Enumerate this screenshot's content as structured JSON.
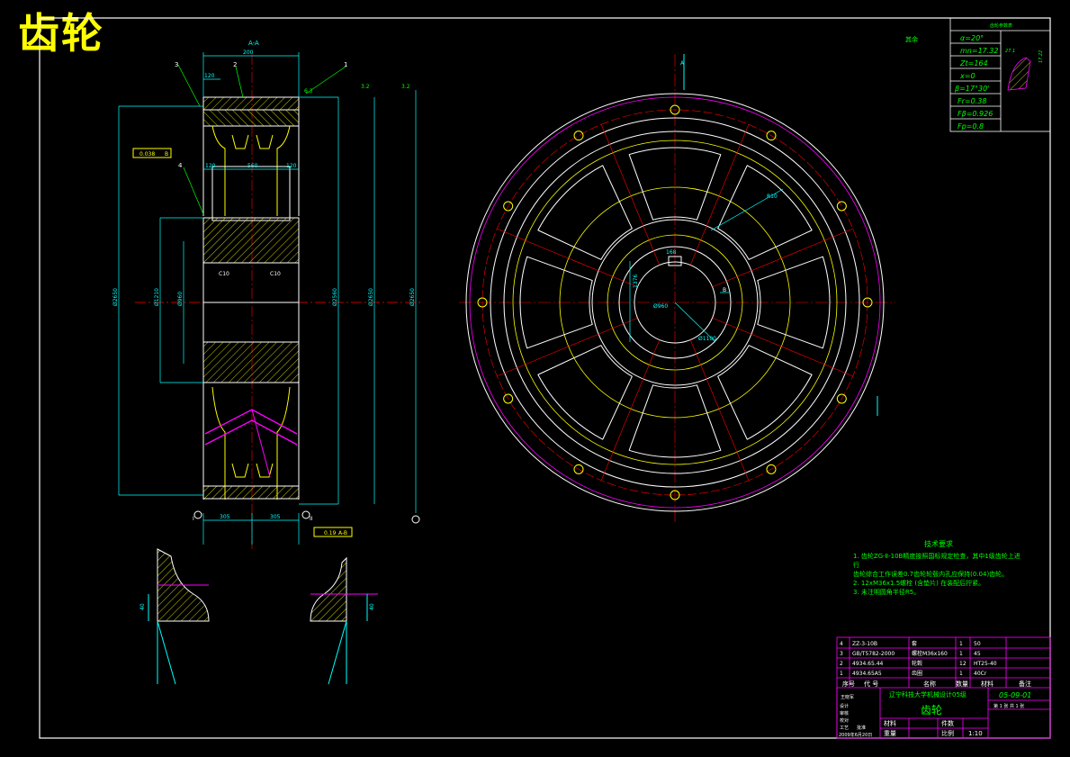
{
  "title": "齿轮",
  "section_label": "A-A",
  "view_label_a": "A",
  "dimensions": {
    "top_width": "200",
    "hub_width": "560",
    "rim_120_left": "120",
    "rim_120_right": "120",
    "rim_120_top": "120",
    "bottom_305_left": "305",
    "bottom_305_right": "305",
    "chamfer_left": "C10",
    "chamfer_right": "C10",
    "keyway_width": "168",
    "keyway_depth": "1376",
    "bore_dia": "Ø960",
    "radius_r10": "R10",
    "dia_1": "Ø2650",
    "dia_2": "Ø2560",
    "dia_3": "Ø2650",
    "dia_4": "Ø2650",
    "dia_5": "Ø1210",
    "dia_6": "Ø960",
    "dia_7": "Ø1100",
    "rough_1": "6.3",
    "rough_2": "3.2",
    "rough_3": "3.2",
    "tol_box": "0.038",
    "tol_letter": "B",
    "runout_box": "0.19",
    "runout_ref": "A-B",
    "mark_I": "I",
    "mark_II": "II",
    "datum_b": "B"
  },
  "callouts": [
    "1",
    "2",
    "3",
    "4"
  ],
  "surface_other": "其余",
  "detail_dim_left": "40",
  "detail_dim_right": "40",
  "gear_params": {
    "header": "齿轮参数表",
    "rows": [
      "α=20°",
      "mn=17.32",
      "Zt=164",
      "x=0",
      "β=17°30'",
      "Fr=0.38",
      "Fβ=0.926",
      "Fp=0.8"
    ],
    "small_dims": [
      "27.1",
      "17.22"
    ]
  },
  "technical_requirements": {
    "title": "技术要求",
    "items": [
      "1. 齿轮ZG-Ⅱ-10B精度按照国标规定检查，其中1级齿轮上进行",
      "   齿轮综合工作误差0.7齿轮轮毂内孔应保持(0.04)齿轮。",
      "2. 12xM36x1.5螺栓 (含垫片) 在装配后拧紧。",
      "3. 未注明圆角半径R5。"
    ]
  },
  "parts_list": {
    "rows": [
      {
        "no": "4",
        "code": "ZZ-3-10B",
        "name": "套",
        "qty": "1",
        "material": "50",
        "note": ""
      },
      {
        "no": "3",
        "code": "GB/T5782-2000",
        "name": "螺栓M36x160",
        "qty": "1",
        "material": "45",
        "note": ""
      },
      {
        "no": "2",
        "code": "4934.65.44",
        "name": "轮毂",
        "qty": "12",
        "material": "HT25-40",
        "note": ""
      },
      {
        "no": "1",
        "code": "4934.65A5",
        "name": "齿圈",
        "qty": "1",
        "material": "40Cr",
        "note": ""
      }
    ],
    "header": {
      "no": "序号",
      "code": "代  号",
      "name": "名称",
      "qty": "数量",
      "material": "材料",
      "note": "备注"
    }
  },
  "title_block": {
    "school": "辽宁科技大学机械设计05级",
    "drawing_no": "05-09-01",
    "part_name": "齿轮",
    "designer": "王晓军",
    "date": "2009年6月20日",
    "scale_label": "比例",
    "scale": "1:10",
    "sheet": "第 1 张  共 1 张",
    "weight_label": "重量",
    "qty_label": "件数",
    "material_label": "材料",
    "roles": [
      "设计",
      "审核",
      "校对",
      "工艺",
      "批准"
    ]
  },
  "colors": {
    "background": "#000000",
    "frame": "#ffffff",
    "part_outline": "#ffffff",
    "hatching": "#ffff00",
    "centerline": "#ff0000",
    "dimension": "#00ffff",
    "annotation": "#00ff00",
    "tooth": "#ff00ff",
    "table_grid": "#ff00ff",
    "title": "#ffff00"
  }
}
